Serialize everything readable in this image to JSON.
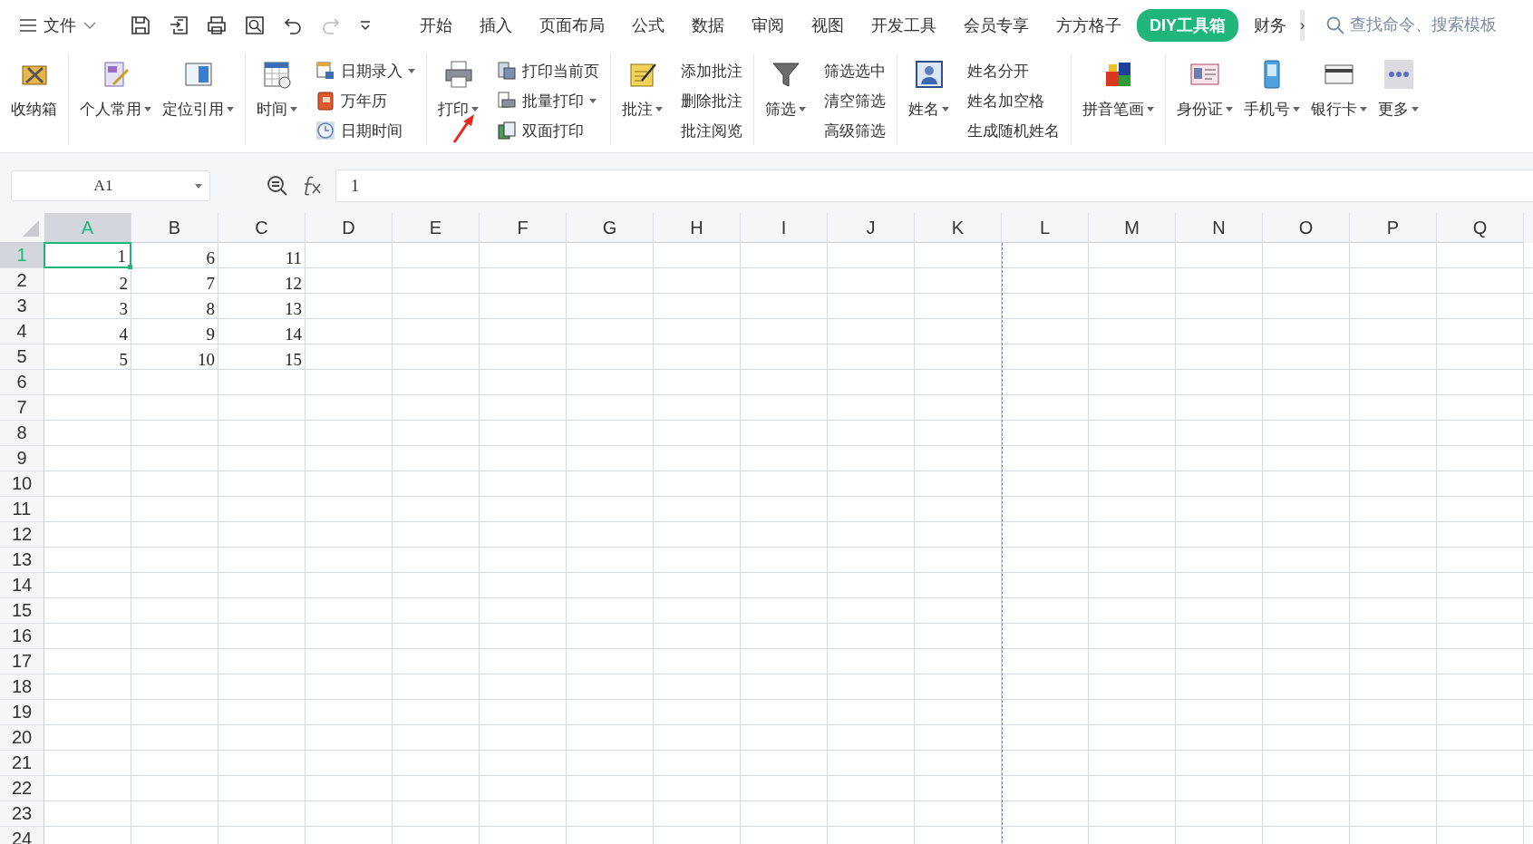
{
  "menu": {
    "file": "文件",
    "tabs": [
      {
        "label": "开始",
        "selected": false
      },
      {
        "label": "插入",
        "selected": false
      },
      {
        "label": "页面布局",
        "selected": false
      },
      {
        "label": "公式",
        "selected": false
      },
      {
        "label": "数据",
        "selected": false
      },
      {
        "label": "审阅",
        "selected": false
      },
      {
        "label": "视图",
        "selected": false
      },
      {
        "label": "开发工具",
        "selected": false
      },
      {
        "label": "会员专享",
        "selected": false
      },
      {
        "label": "方方格子",
        "selected": false
      },
      {
        "label": "DIY工具箱",
        "selected": true
      },
      {
        "label": "财务",
        "selected": false
      }
    ],
    "more": "›",
    "search": {
      "placeholder": "查找命令、搜索模板"
    }
  },
  "ribbon": {
    "groups": [
      {
        "items": [
          {
            "kind": "large",
            "label": "收纳箱",
            "dropdown": false
          }
        ]
      },
      {
        "items": [
          {
            "kind": "large",
            "label": "个人常用",
            "dropdown": true
          },
          {
            "kind": "large",
            "label": "定位引用",
            "dropdown": true
          }
        ]
      },
      {
        "items": [
          {
            "kind": "large",
            "label": "时间",
            "dropdown": true
          },
          {
            "kind": "icon",
            "label": "日期录入",
            "dropdown": true
          },
          {
            "kind": "icon",
            "label": "万年历",
            "dropdown": false
          },
          {
            "kind": "icon",
            "label": "日期时间",
            "dropdown": false
          }
        ]
      },
      {
        "items": [
          {
            "kind": "large",
            "label": "打印",
            "dropdown": true
          },
          {
            "kind": "icon",
            "label": "打印当前页",
            "dropdown": false
          },
          {
            "kind": "icon",
            "label": "批量打印",
            "dropdown": true
          },
          {
            "kind": "icon",
            "label": "双面打印",
            "dropdown": false
          }
        ]
      },
      {
        "items": [
          {
            "kind": "large",
            "label": "批注",
            "dropdown": true
          },
          {
            "kind": "text",
            "label": "添加批注",
            "dropdown": false
          },
          {
            "kind": "text",
            "label": "删除批注",
            "dropdown": false
          },
          {
            "kind": "text",
            "label": "批注阅览",
            "dropdown": false
          }
        ]
      },
      {
        "items": [
          {
            "kind": "large",
            "label": "筛选",
            "dropdown": true
          },
          {
            "kind": "text",
            "label": "筛选选中",
            "dropdown": false
          },
          {
            "kind": "text",
            "label": "清空筛选",
            "dropdown": false
          },
          {
            "kind": "text",
            "label": "高级筛选",
            "dropdown": false
          }
        ]
      },
      {
        "items": [
          {
            "kind": "large",
            "label": "姓名",
            "dropdown": true
          },
          {
            "kind": "text",
            "label": "姓名分开",
            "dropdown": false
          },
          {
            "kind": "text",
            "label": "姓名加空格",
            "dropdown": false
          },
          {
            "kind": "text",
            "label": "生成随机姓名",
            "dropdown": false
          }
        ]
      },
      {
        "items": [
          {
            "kind": "large",
            "label": "拼音笔画",
            "dropdown": true
          }
        ]
      },
      {
        "items": [
          {
            "kind": "large",
            "label": "身份证",
            "dropdown": true
          },
          {
            "kind": "large",
            "label": "手机号",
            "dropdown": true
          },
          {
            "kind": "large",
            "label": "银行卡",
            "dropdown": true
          },
          {
            "kind": "large",
            "label": "更多",
            "dropdown": true
          }
        ]
      }
    ]
  },
  "formula_bar": {
    "name_box": "A1",
    "formula": "1"
  },
  "sheet": {
    "columns": [
      {
        "label": "A",
        "selected": true
      },
      {
        "label": "B",
        "selected": false
      },
      {
        "label": "C",
        "selected": false
      },
      {
        "label": "D",
        "selected": false
      },
      {
        "label": "E",
        "selected": false
      },
      {
        "label": "F",
        "selected": false
      },
      {
        "label": "G",
        "selected": false
      },
      {
        "label": "H",
        "selected": false
      },
      {
        "label": "I",
        "selected": false
      },
      {
        "label": "J",
        "selected": false
      },
      {
        "label": "K",
        "selected": false
      },
      {
        "label": "L",
        "selected": false
      },
      {
        "label": "M",
        "selected": false
      },
      {
        "label": "N",
        "selected": false
      },
      {
        "label": "O",
        "selected": false
      },
      {
        "label": "P",
        "selected": false
      },
      {
        "label": "Q",
        "selected": false
      }
    ],
    "rows": [
      {
        "label": "1",
        "selected": true,
        "cells": [
          {
            "value": "1",
            "selected": true
          },
          {
            "value": "6",
            "selected": false
          },
          {
            "value": "11",
            "selected": false
          }
        ]
      },
      {
        "label": "2",
        "selected": false,
        "cells": [
          {
            "value": "2",
            "selected": false
          },
          {
            "value": "7",
            "selected": false
          },
          {
            "value": "12",
            "selected": false
          }
        ]
      },
      {
        "label": "3",
        "selected": false,
        "cells": [
          {
            "value": "3",
            "selected": false
          },
          {
            "value": "8",
            "selected": false
          },
          {
            "value": "13",
            "selected": false
          }
        ]
      },
      {
        "label": "4",
        "selected": false,
        "cells": [
          {
            "value": "4",
            "selected": false
          },
          {
            "value": "9",
            "selected": false
          },
          {
            "value": "14",
            "selected": false
          }
        ]
      },
      {
        "label": "5",
        "selected": false,
        "cells": [
          {
            "value": "5",
            "selected": false
          },
          {
            "value": "10",
            "selected": false
          },
          {
            "value": "15",
            "selected": false
          }
        ]
      },
      {
        "label": "6",
        "selected": false
      },
      {
        "label": "7",
        "selected": false
      },
      {
        "label": "8",
        "selected": false
      },
      {
        "label": "9",
        "selected": false
      },
      {
        "label": "10",
        "selected": false
      },
      {
        "label": "11",
        "selected": false
      },
      {
        "label": "12",
        "selected": false
      },
      {
        "label": "13",
        "selected": false
      },
      {
        "label": "14",
        "selected": false
      },
      {
        "label": "15",
        "selected": false
      },
      {
        "label": "16",
        "selected": false
      },
      {
        "label": "17",
        "selected": false
      },
      {
        "label": "18",
        "selected": false
      },
      {
        "label": "19",
        "selected": false
      },
      {
        "label": "20",
        "selected": false
      },
      {
        "label": "21",
        "selected": false
      },
      {
        "label": "22",
        "selected": false
      },
      {
        "label": "23",
        "selected": false
      },
      {
        "label": "24",
        "selected": false
      }
    ]
  }
}
